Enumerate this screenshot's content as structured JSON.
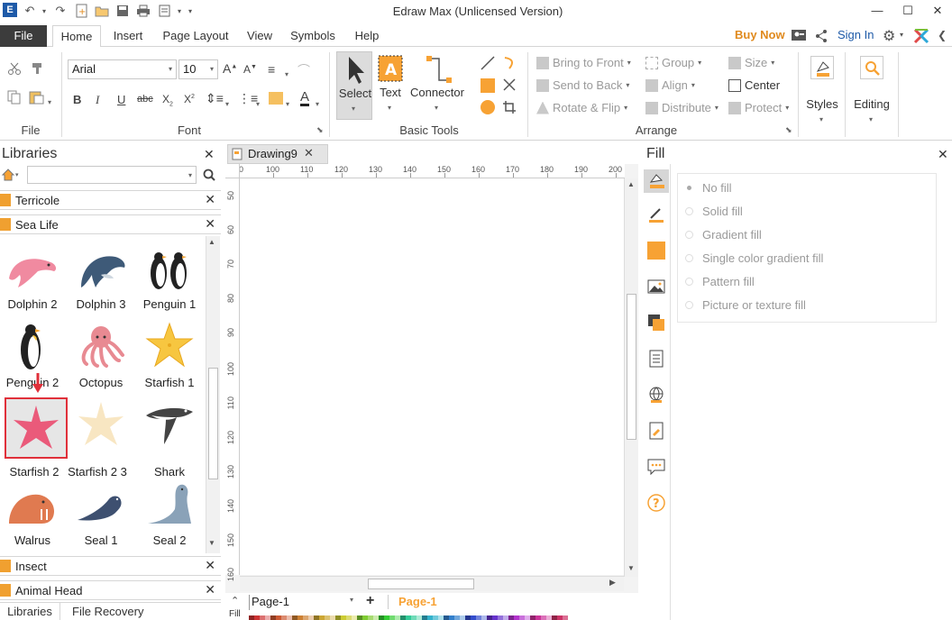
{
  "window": {
    "title": "Edraw Max (Unlicensed Version)",
    "minimize": "—",
    "maximize": "☐",
    "close": "✕"
  },
  "menu": {
    "file": "File",
    "tabs": [
      "Home",
      "Insert",
      "Page Layout",
      "View",
      "Symbols",
      "Help"
    ],
    "buy_now": "Buy Now",
    "sign_in": "Sign In"
  },
  "ribbon": {
    "file_group_label": "File",
    "font": {
      "family": "Arial",
      "size": "10",
      "group_label": "Font"
    },
    "basic_tools": {
      "select": "Select",
      "text": "Text",
      "connector": "Connector",
      "group_label": "Basic Tools"
    },
    "arrange": {
      "bring_to_front": "Bring to Front",
      "send_to_back": "Send to Back",
      "rotate_flip": "Rotate & Flip",
      "group": "Group",
      "align": "Align",
      "distribute": "Distribute",
      "size": "Size",
      "center": "Center",
      "protect": "Protect",
      "group_label": "Arrange"
    },
    "styles": "Styles",
    "editing": "Editing"
  },
  "libraries": {
    "title": "Libraries",
    "search_value": "",
    "categories_top": [
      "Terricole",
      "Sea Life"
    ],
    "categories_bottom": [
      "Insect",
      "Animal Head"
    ],
    "shapes": [
      {
        "name": "Dolphin 2",
        "icon": "pink-dolphin"
      },
      {
        "name": "Dolphin 3",
        "icon": "blue-dolphin"
      },
      {
        "name": "Penguin 1",
        "icon": "penguins"
      },
      {
        "name": "Penguin 2",
        "icon": "penguin"
      },
      {
        "name": "Octopus",
        "icon": "octopus"
      },
      {
        "name": "Starfish 1",
        "icon": "yellow-starfish"
      },
      {
        "name": "Starfish 2",
        "icon": "pink-starfish"
      },
      {
        "name": "Starfish 2  3",
        "icon": "cream-starfish"
      },
      {
        "name": "Shark",
        "icon": "shark"
      },
      {
        "name": "Walrus",
        "icon": "walrus"
      },
      {
        "name": "Seal 1",
        "icon": "seal"
      },
      {
        "name": "Seal 2",
        "icon": "grey-seal"
      }
    ],
    "bottom_tabs": [
      "Libraries",
      "File Recovery"
    ]
  },
  "document": {
    "tab_name": "Drawing9",
    "h_ruler_ticks": [
      "0",
      "100",
      "110",
      "120",
      "130",
      "140",
      "150",
      "160",
      "170",
      "180",
      "190",
      "200"
    ],
    "v_ruler_ticks": [
      "50",
      "60",
      "70",
      "80",
      "90",
      "100",
      "110",
      "120",
      "130",
      "140",
      "150",
      "160"
    ],
    "page_selector": "Page-1",
    "active_page": "Page-1",
    "fill_label": "Fill"
  },
  "fill_panel": {
    "title": "Fill",
    "options": [
      "No fill",
      "Solid fill",
      "Gradient fill",
      "Single color gradient fill",
      "Pattern fill",
      "Picture or texture fill"
    ],
    "selected": "No fill"
  },
  "colors": {
    "accent_orange": "#f7a234",
    "buy_now": "#e08a1e",
    "sign_in_blue": "#1e5aa8",
    "file_tab": "#3c3c3c",
    "highlight_red": "#e0303a"
  }
}
